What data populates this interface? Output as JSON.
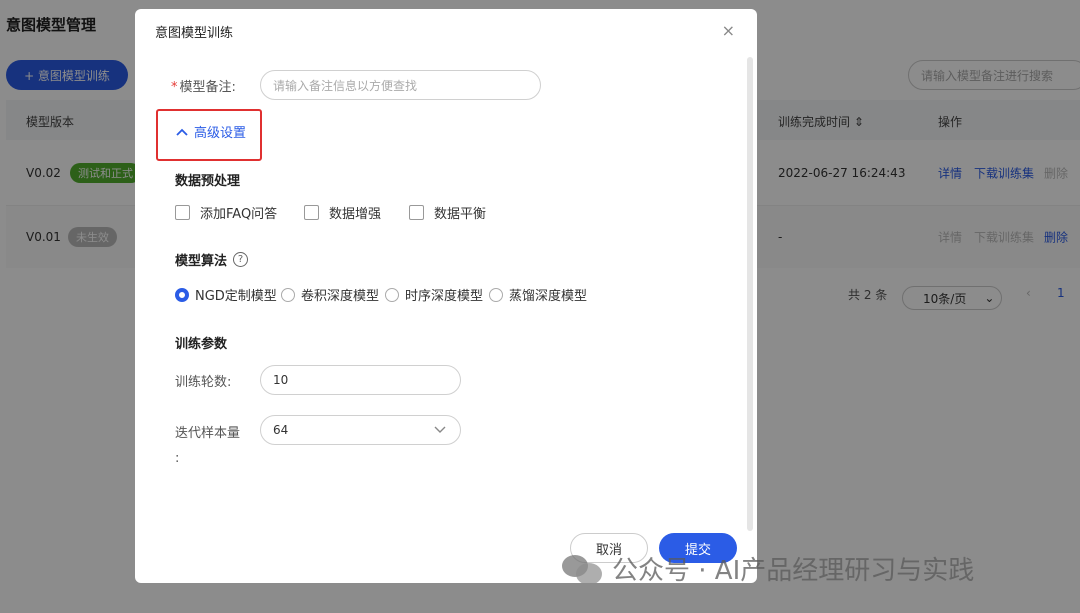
{
  "page": {
    "title": "意图模型管理",
    "add_button": "+ 意图模型训练",
    "search_placeholder": "请输入模型备注进行搜索",
    "table": {
      "headers": {
        "version": "模型版本",
        "finish_time": "训练完成时间 ⇕",
        "actions": "操作"
      },
      "rows": [
        {
          "version": "V0.02",
          "status": "测试和正式",
          "finish_time": "2022-06-27 16:24:43",
          "action_detail": "详情",
          "action_download": "下载训练集",
          "action_delete": "删除"
        },
        {
          "version": "V0.01",
          "status": "未生效",
          "finish_time": "-",
          "action_detail": "详情",
          "action_download": "下载训练集",
          "action_delete": "删除"
        }
      ]
    },
    "pager": {
      "total": "共 2 条",
      "page_size": "10条/页",
      "prev": "‹",
      "current": "1"
    }
  },
  "modal": {
    "title": "意图模型训练",
    "close": "×",
    "remark_label": "模型备注:",
    "remark_required": "*",
    "remark_placeholder": "请输入备注信息以方便查找",
    "advanced_toggle": "高级设置",
    "preprocess_title": "数据预处理",
    "checkboxes": [
      "添加FAQ问答",
      "数据增强",
      "数据平衡"
    ],
    "algorithm_title": "模型算法",
    "algorithms": [
      "NGD定制模型",
      "卷积深度模型",
      "时序深度模型",
      "蒸馏深度模型"
    ],
    "algorithm_selected_index": 0,
    "training_title": "训练参数",
    "epochs_label": "训练轮数:",
    "epochs_value": "10",
    "batch_label": "迭代样本量",
    "batch_colon": ":",
    "batch_value": "64",
    "cancel": "取消",
    "submit": "提交"
  },
  "watermark": "公众号 · AI产品经理研习与实践",
  "colors": {
    "primary": "#2b5ce6",
    "danger_box": "#e03030",
    "tag_green": "#52b02e"
  }
}
